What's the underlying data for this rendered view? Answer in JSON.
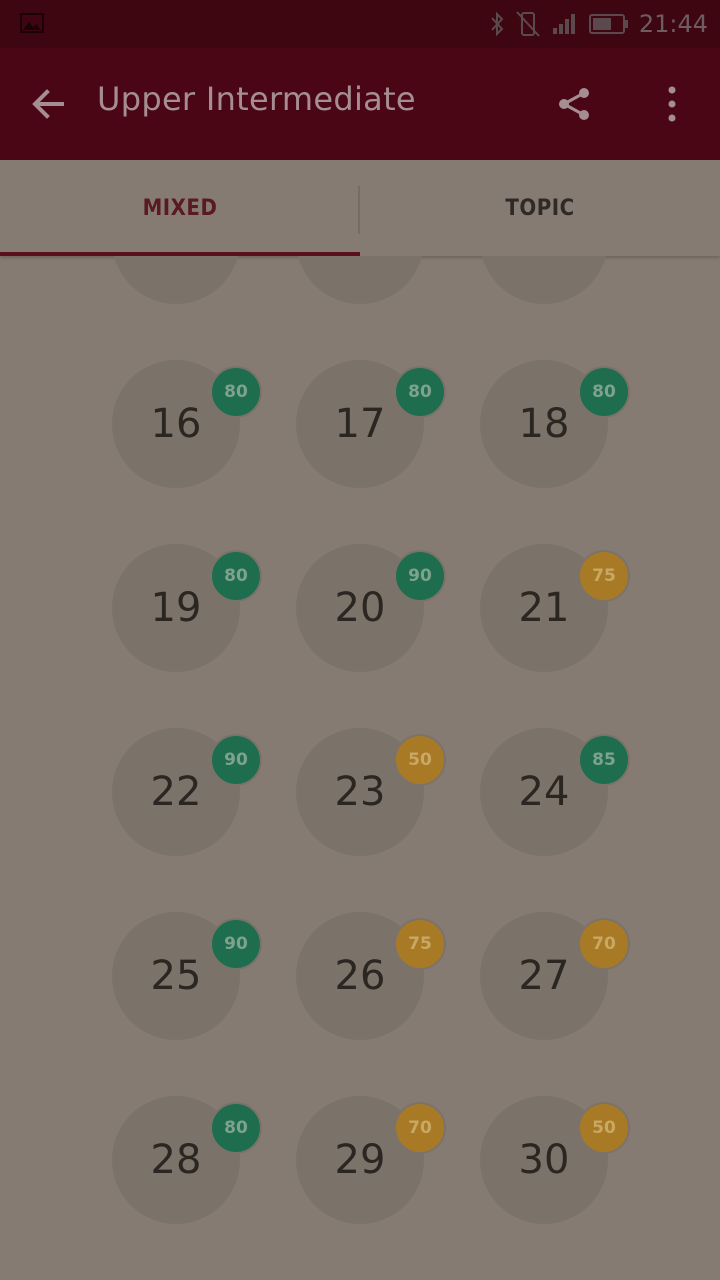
{
  "status_bar": {
    "time": "21:44",
    "icons": [
      "image-icon",
      "bluetooth-icon",
      "vibrate-icon",
      "signal-icon",
      "battery-icon"
    ]
  },
  "app_bar": {
    "title": "Upper Intermediate",
    "back_icon": "arrow-back-icon",
    "share_icon": "share-icon",
    "more_icon": "more-vert-icon"
  },
  "tabs": [
    {
      "label": "MIXED",
      "selected": true
    },
    {
      "label": "TOPIC",
      "selected": false
    }
  ],
  "colors": {
    "green_badge": "#1f6d4f",
    "orange_badge": "#a87a26",
    "accent": "#5a0f1c"
  },
  "lessons": [
    {
      "number": "16",
      "score": "80",
      "tone": "green"
    },
    {
      "number": "17",
      "score": "80",
      "tone": "green"
    },
    {
      "number": "18",
      "score": "80",
      "tone": "green"
    },
    {
      "number": "19",
      "score": "80",
      "tone": "green"
    },
    {
      "number": "20",
      "score": "90",
      "tone": "green"
    },
    {
      "number": "21",
      "score": "75",
      "tone": "orange"
    },
    {
      "number": "22",
      "score": "90",
      "tone": "green"
    },
    {
      "number": "23",
      "score": "50",
      "tone": "orange"
    },
    {
      "number": "24",
      "score": "85",
      "tone": "green"
    },
    {
      "number": "25",
      "score": "90",
      "tone": "green"
    },
    {
      "number": "26",
      "score": "75",
      "tone": "orange"
    },
    {
      "number": "27",
      "score": "70",
      "tone": "orange"
    },
    {
      "number": "28",
      "score": "80",
      "tone": "green"
    },
    {
      "number": "29",
      "score": "70",
      "tone": "orange"
    },
    {
      "number": "30",
      "score": "50",
      "tone": "orange"
    }
  ]
}
